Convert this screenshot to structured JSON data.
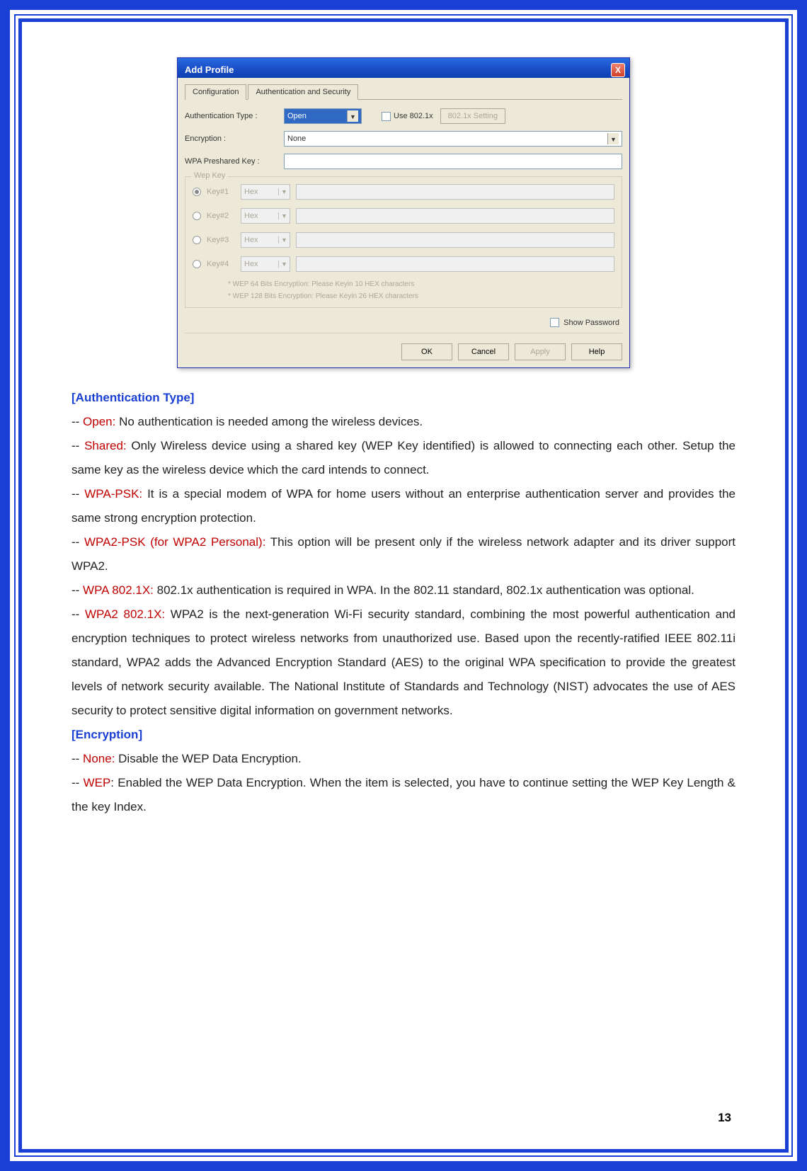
{
  "dialog": {
    "title": "Add Profile",
    "close": "X",
    "tabs": {
      "config": "Configuration",
      "auth": "Authentication and Security"
    },
    "auth_type_label": "Authentication Type :",
    "auth_type_value": "Open",
    "use8021x": "Use 802.1x",
    "setting8021x": "802.1x Setting",
    "encryption_label": "Encryption :",
    "encryption_value": "None",
    "psk_label": "WPA Preshared Key :",
    "wep_group": "Wep Key",
    "wep": [
      {
        "label": "Key#1",
        "type": "Hex"
      },
      {
        "label": "Key#2",
        "type": "Hex"
      },
      {
        "label": "Key#3",
        "type": "Hex"
      },
      {
        "label": "Key#4",
        "type": "Hex"
      }
    ],
    "hint1": "* WEP 64 Bits Encryption:   Please Keyin 10 HEX characters",
    "hint2": "* WEP 128 Bits Encryption:   Please Keyin 26 HEX characters",
    "show_pwd": "Show Password",
    "ok": "OK",
    "cancel": "Cancel",
    "apply": "Apply",
    "help": "Help"
  },
  "doc": {
    "auth_head": "[Authentication Type]",
    "open_term": "Open:",
    "open_text": " No authentication is needed among the wireless devices.",
    "shared_term": "Shared:",
    "shared_text": " Only Wireless device using a shared key (WEP Key identified) is allowed to connecting each other. Setup the same key as the wireless device which the card intends to connect.",
    "wpapsk_term": "WPA-PSK:",
    "wpapsk_text": " It is a special modem of WPA for home users without an enterprise authentication server and provides the same strong encryption protection.",
    "wpa2psk_term": "WPA2-PSK (for WPA2 Personal):",
    "wpa2psk_text": " This option will be present only if the wireless network adapter and its driver support WPA2.",
    "wpa8021x_term": "WPA 802.1X:",
    "wpa8021x_text": " 802.1x authentication is required in WPA. In the 802.11 standard, 802.1x authentication was optional.",
    "wpa28021x_term": "WPA2 802.1X:",
    "wpa28021x_text": " WPA2 is the next-generation Wi-Fi security standard, combining the most powerful authentication and encryption techniques to protect wireless networks from unauthorized use. Based upon the recently-ratified IEEE 802.11i standard, WPA2 adds the Advanced Encryption Standard (AES) to the original WPA specification to provide the greatest levels of network security available. The National Institute of Standards and Technology (NIST) advocates the use of AES security to protect sensitive digital information on government networks.",
    "enc_head": "[Encryption]",
    "none_term": "None:",
    "none_text": " Disable the WEP Data Encryption.",
    "wep_term": "WEP",
    "wep_text": ": Enabled the WEP Data Encryption. When the item is selected, you have to continue setting the WEP Key Length & the key Index."
  },
  "page": "13"
}
